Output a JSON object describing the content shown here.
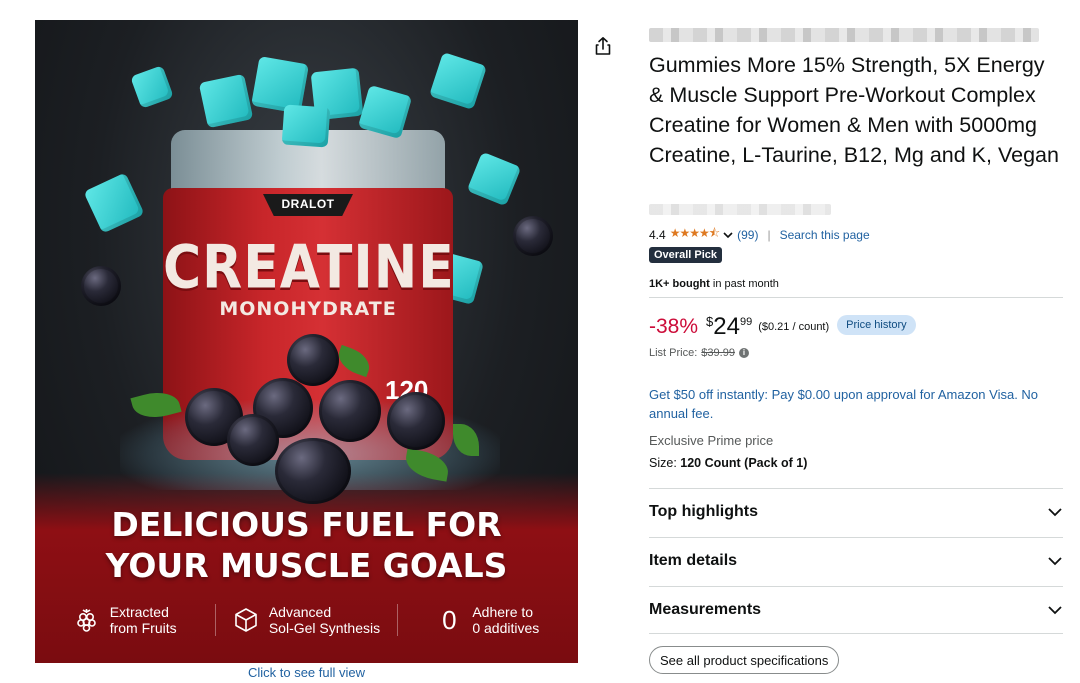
{
  "image": {
    "brand_logo": "DRALOT",
    "jar_title": "CREATINE",
    "jar_subtitle": "MONOHYDRATE",
    "jar_count": "120",
    "headline_line1": "DELICIOUS FUEL FOR",
    "headline_line2": "YOUR MUSCLE GOALS",
    "features": [
      {
        "icon": "raspberry-icon",
        "line1": "Extracted",
        "line2": "from Fruits"
      },
      {
        "icon": "cube-icon",
        "line1": "Advanced",
        "line2": "Sol-Gel Synthesis"
      },
      {
        "icon": "zero-icon",
        "glyph": "0",
        "line1": "Adhere to",
        "line2": "0 additives"
      }
    ],
    "full_view_link": "Click to see full view"
  },
  "product": {
    "title": "Gummies More 15% Strength, 5X Energy & Muscle Support Pre-Workout Complex Creatine for Women & Men with 5000mg Creatine, L-Taurine, B12, Mg and K, Vegan",
    "rating_value": "4.4",
    "stars": "★★★★⯪",
    "rating_count": "(99)",
    "search_link": "Search this page",
    "badge": "Overall Pick",
    "bought_bold": "1K+ bought",
    "bought_rest": " in past month",
    "discount": "-38%",
    "price_symbol": "$",
    "price_whole": "24",
    "price_fraction": "99",
    "unit_price": "($0.21 / count)",
    "price_history": "Price history",
    "list_price_label": "List Price: ",
    "list_price": "$39.99",
    "offer": "Get $50 off instantly: Pay $0.00 upon approval for Amazon Visa. No annual fee.",
    "exclusive": "Exclusive Prime price",
    "size_label": "Size: ",
    "size_value": "120 Count (Pack of 1)"
  },
  "sections": [
    {
      "label": "Top highlights"
    },
    {
      "label": "Item details"
    },
    {
      "label": "Measurements"
    }
  ],
  "spec_button": "See all product specifications",
  "colors": {
    "discount": "#cc0c39",
    "link": "#2162a1",
    "badge": "#232f3e",
    "star": "#de7921"
  }
}
